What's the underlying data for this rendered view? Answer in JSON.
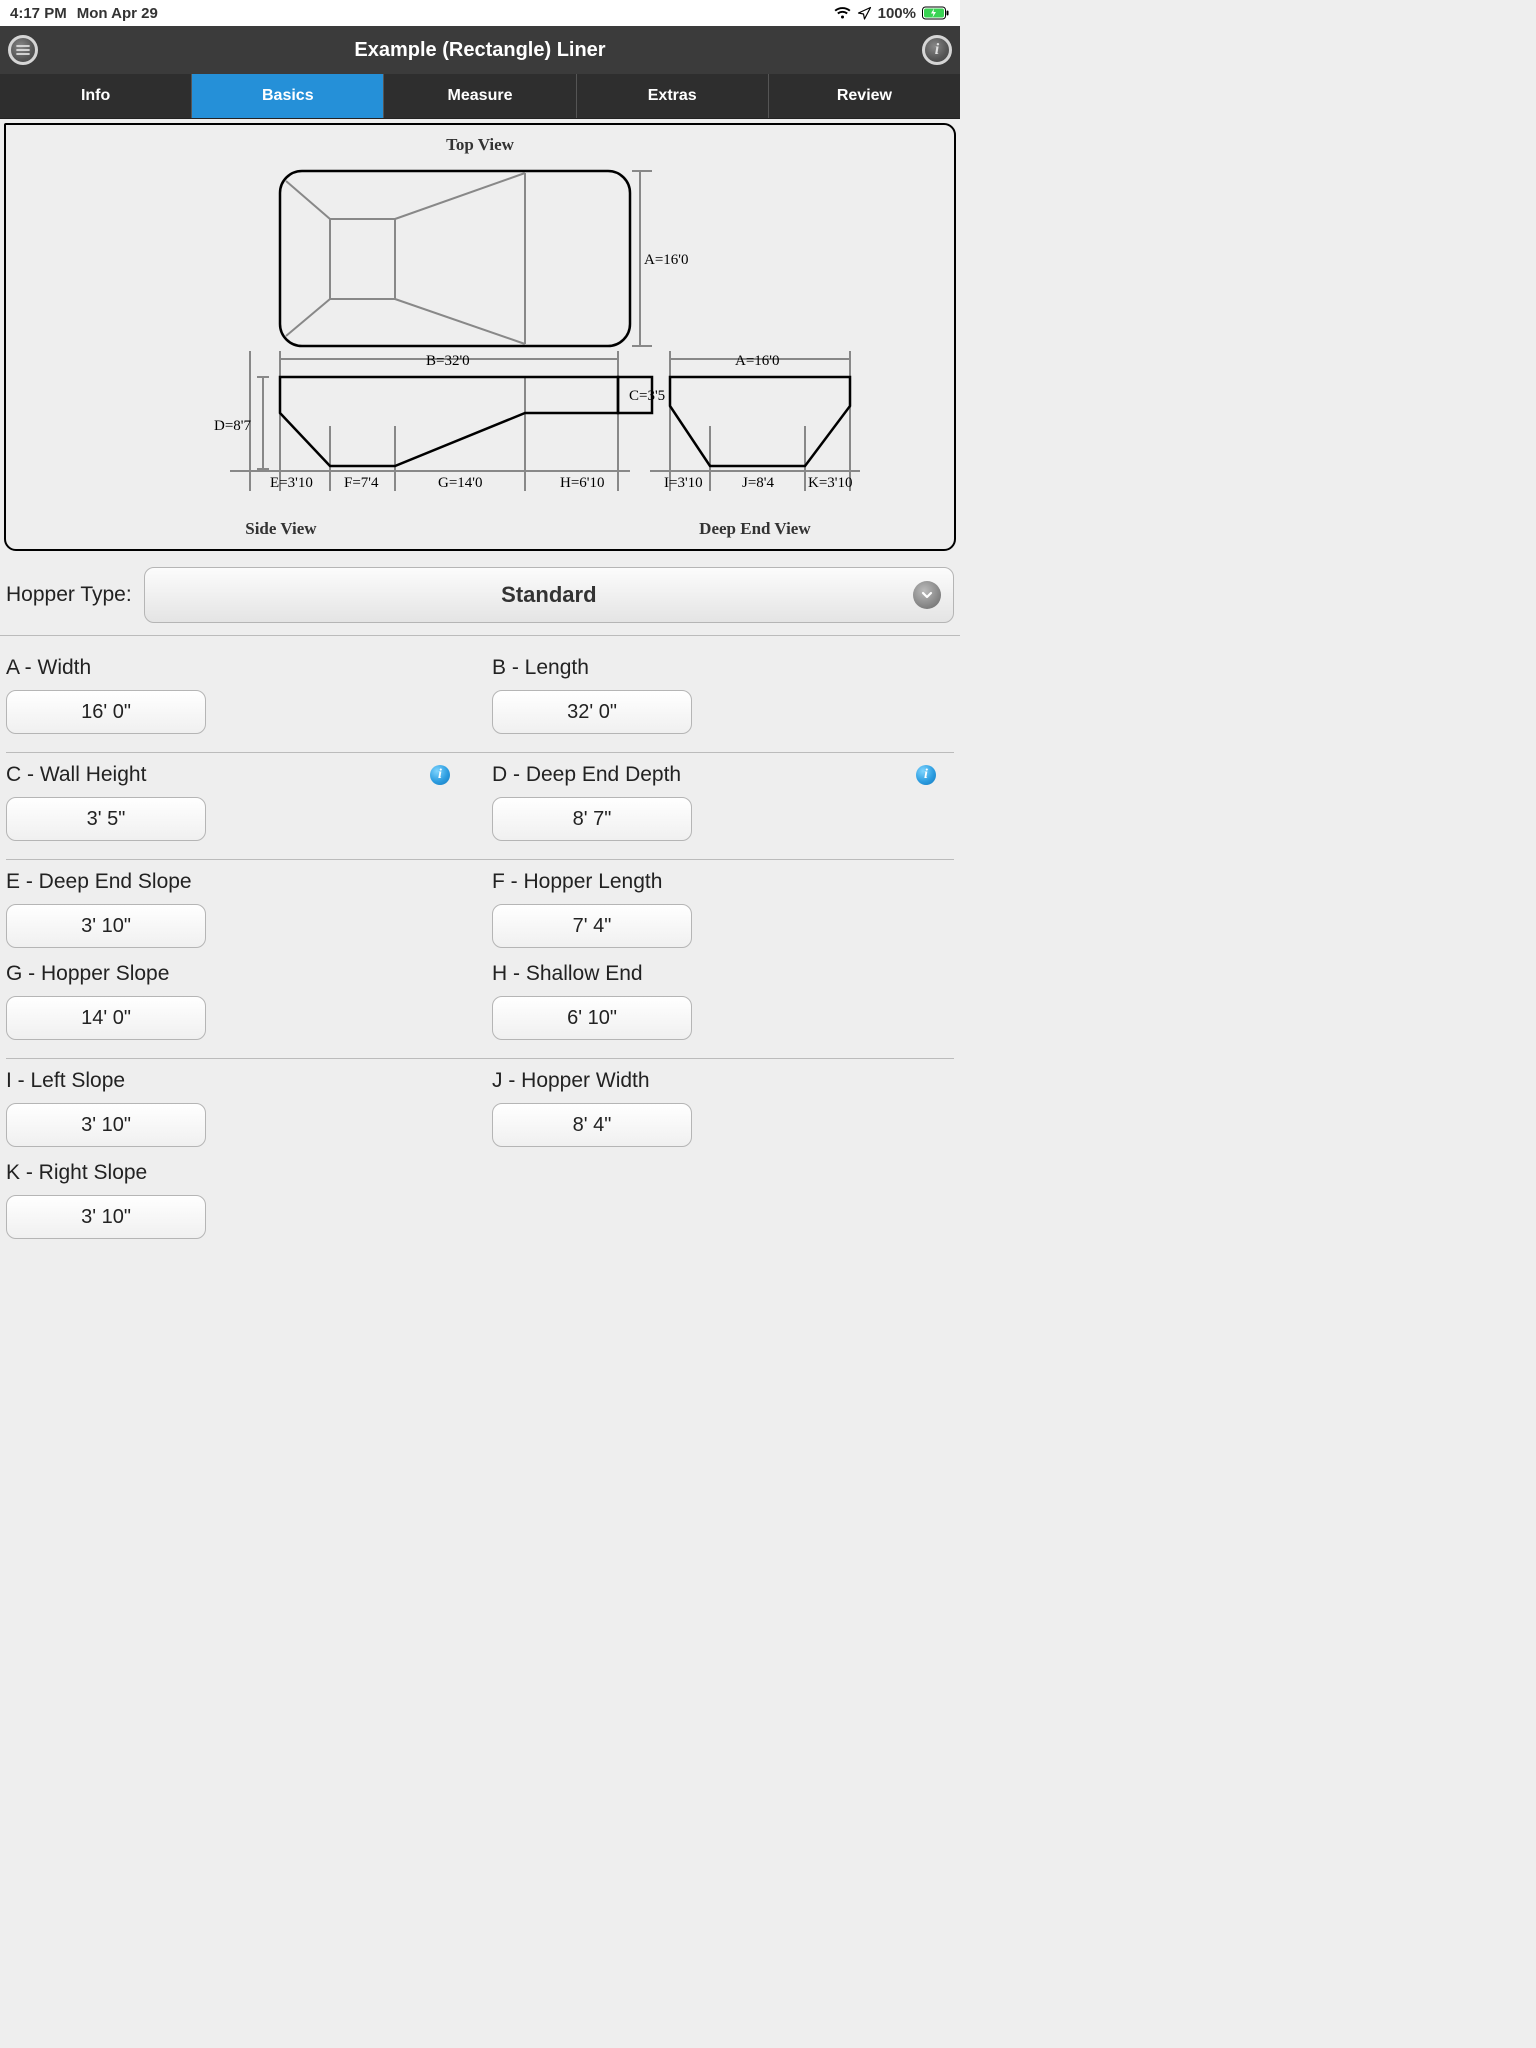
{
  "status": {
    "time": "4:17 PM",
    "date": "Mon Apr 29",
    "battery": "100%"
  },
  "header": {
    "title": "Example (Rectangle) Liner"
  },
  "tabs": {
    "info": "Info",
    "basics": "Basics",
    "measure": "Measure",
    "extras": "Extras",
    "review": "Review"
  },
  "diagram": {
    "topViewTitle": "Top View",
    "sideViewTitle": "Side View",
    "deepEndViewTitle": "Deep End View",
    "A": "A=16'0",
    "B": "B=32'0",
    "C": "C=3'5",
    "D": "D=8'7",
    "E": "E=3'10",
    "F": "F=7'4",
    "G": "G=14'0",
    "H": "H=6'10",
    "I": "I=3'10",
    "J": "J=8'4",
    "K": "K=3'10",
    "A2": "A=16'0"
  },
  "hopper": {
    "label": "Hopper Type:",
    "selected": "Standard"
  },
  "fields": {
    "A": {
      "label": "A - Width",
      "value": "16' 0\""
    },
    "B": {
      "label": "B - Length",
      "value": "32' 0\""
    },
    "C": {
      "label": "C - Wall Height",
      "value": "3' 5\""
    },
    "D": {
      "label": "D - Deep End Depth",
      "value": "8' 7\""
    },
    "E": {
      "label": "E - Deep End Slope",
      "value": "3' 10\""
    },
    "F": {
      "label": "F - Hopper Length",
      "value": "7' 4\""
    },
    "G": {
      "label": "G - Hopper Slope",
      "value": "14' 0\""
    },
    "H": {
      "label": "H - Shallow End",
      "value": "6' 10\""
    },
    "I": {
      "label": "I - Left Slope",
      "value": "3' 10\""
    },
    "J": {
      "label": "J - Hopper Width",
      "value": "8' 4\""
    },
    "K": {
      "label": "K - Right Slope",
      "value": "3' 10\""
    }
  }
}
